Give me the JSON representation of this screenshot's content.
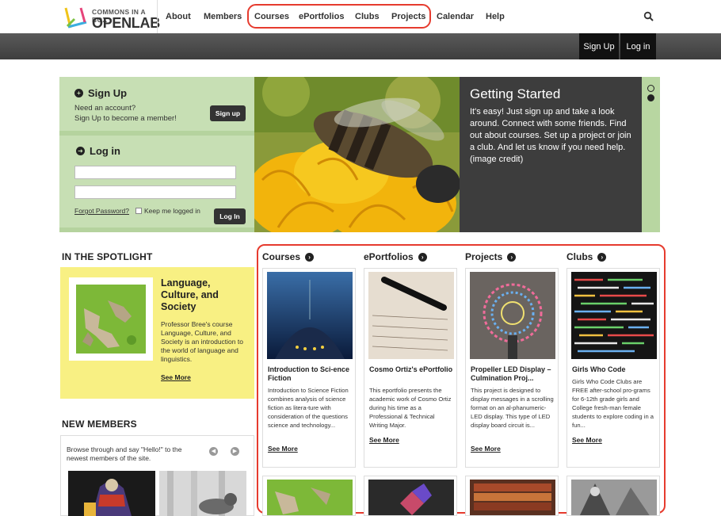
{
  "brand": {
    "line1": "COMMONS IN A BOX",
    "line2": "OPENLAB"
  },
  "nav": {
    "about": "About",
    "members": "Members",
    "courses": "Courses",
    "eportfolios": "ePortfolios",
    "clubs": "Clubs",
    "projects": "Projects",
    "calendar": "Calendar",
    "help": "Help"
  },
  "topbar": {
    "signup": "Sign Up",
    "login": "Log in"
  },
  "signup_box": {
    "title": "Sign Up",
    "line1": "Need an account?",
    "line2": "Sign Up to become a member!",
    "button": "Sign up"
  },
  "login_box": {
    "title": "Log in",
    "username_value": "",
    "password_value": "",
    "forgot": "Forgot Password?",
    "keep": "Keep me logged in",
    "button": "Log In"
  },
  "hero": {
    "title": "Getting Started",
    "text": "It's easy! Just sign up and take a look around. Connect with some friends. Find out about courses. Set up a project or join a club. And let us know if you need help. (image credit)",
    "slides": 2,
    "active_slide": 2
  },
  "spotlight": {
    "heading": "IN THE SPOTLIGHT",
    "title": "Language, Culture, and Society",
    "desc": "Professor Bree's course Language, Culture, and Society is an introduction to the world of language and linguistics.",
    "see_more": "See More"
  },
  "new_members": {
    "heading": "NEW MEMBERS",
    "desc": "Browse through and say \"Hello!\" to the newest members of the site."
  },
  "columns": [
    {
      "heading": "Courses",
      "card_title": "Introduction to Sci-ence Fiction",
      "card_desc": "Introduction to Science Fiction combines analysis of science fiction as litera-ture with consideration of the questions science and technology...",
      "see_more": "See More"
    },
    {
      "heading": "ePortfolios",
      "card_title": "Cosmo Ortiz's ePortfolio",
      "card_desc": "This eportfolio presents the academic work of Cosmo Ortiz during his time as a Professional & Technical Writing Major.",
      "see_more": "See More"
    },
    {
      "heading": "Projects",
      "card_title": "Propeller LED Display – Culmination Proj...",
      "card_desc": "This project is designed to display messages in a scrolling format on an al-phanumeric-LED display. This type of LED display board circuit is...",
      "see_more": "See More"
    },
    {
      "heading": "Clubs",
      "card_title": "Girls Who Code",
      "card_desc": "Girls Who Code Clubs are FREE after-school pro-grams for 6-12th grade girls and College fresh-man female students to explore coding in a fun...",
      "see_more": "See More"
    }
  ],
  "colors": {
    "accent_highlight": "#e63b2e",
    "login_bg": "#c7dfb4",
    "spotlight_bg": "#f8f083",
    "hero_text_bg": "#3d3d3d"
  }
}
